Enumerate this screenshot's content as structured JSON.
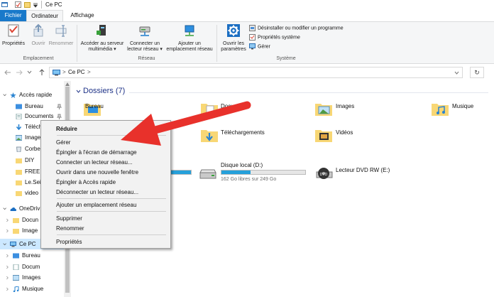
{
  "window": {
    "title": "Ce PC"
  },
  "ribbon_tabs": [
    {
      "label": "Fichier"
    },
    {
      "label": "Ordinateur"
    },
    {
      "label": "Affichage"
    }
  ],
  "ribbon": {
    "buttons": [
      {
        "label": "Propriétés",
        "icon": "checklist-properties-icon"
      },
      {
        "label": "Ouvrir",
        "icon": "open-icon"
      },
      {
        "label": "Renommer",
        "icon": "rename-icon"
      },
      {
        "label_line1": "Accéder au serveur",
        "label_line2": "multimédia ▾",
        "icon": "media-server-icon"
      },
      {
        "label_line1": "Connecter un",
        "label_line2": "lecteur réseau ▾",
        "icon": "network-drive-icon"
      },
      {
        "label_line1": "Ajouter un",
        "label_line2": "emplacement réseau",
        "icon": "network-location-icon"
      },
      {
        "label_line1": "Ouvrir les",
        "label_line2": "paramètres",
        "icon": "settings-gear-icon"
      }
    ],
    "system_items": [
      "Désinstaller ou modifier un programme",
      "Propriétés système",
      "Gérer"
    ],
    "groups": [
      "Emplacement",
      "Réseau",
      "Système"
    ]
  },
  "address": {
    "path_label": "Ce PC",
    "separator": ">",
    "refresh_symbol": "↻"
  },
  "nav_pane": {
    "items": [
      {
        "label": "Accès rapide",
        "icon": "star-icon",
        "level": 0
      },
      {
        "label": "Bureau",
        "icon": "desktop-folder-icon",
        "level": 1,
        "pinned": true
      },
      {
        "label": "Documents",
        "icon": "documents-folder-icon",
        "level": 1,
        "pinned": true
      },
      {
        "label": "Téléch",
        "icon": "download-arrow-icon",
        "level": 1
      },
      {
        "label": "Image",
        "icon": "pictures-folder-icon",
        "level": 1
      },
      {
        "label": "Corbei",
        "icon": "recycle-bin-icon",
        "level": 1
      },
      {
        "label": "DIY",
        "icon": "folder-icon",
        "level": 1
      },
      {
        "label": "FREELA",
        "icon": "folder-icon",
        "level": 1
      },
      {
        "label": "Le.Seig",
        "icon": "folder-icon",
        "level": 1
      },
      {
        "label": "video",
        "icon": "folder-icon",
        "level": 1
      },
      {
        "label": "OneDriv",
        "icon": "onedrive-cloud-icon",
        "level": 0
      },
      {
        "label": "Docun",
        "icon": "folder-icon",
        "level": 1
      },
      {
        "label": "Image",
        "icon": "folder-icon",
        "level": 1
      },
      {
        "label": "Ce PC",
        "icon": "computer-icon",
        "level": 0,
        "selected": true
      },
      {
        "label": "Bureau",
        "icon": "desktop-folder-icon",
        "level": 1
      },
      {
        "label": "Docum",
        "icon": "documents-folder-icon",
        "level": 1
      },
      {
        "label": "Images",
        "icon": "pictures-folder-icon",
        "level": 1
      },
      {
        "label": "Musique",
        "icon": "music-icon",
        "level": 1
      }
    ]
  },
  "content": {
    "folders_header": "Dossiers (7)",
    "folders": [
      {
        "label": "Bureau"
      },
      {
        "label": "Documents"
      },
      {
        "label": "Images"
      },
      {
        "label": "Musique"
      },
      {
        "label": "Téléchargements"
      },
      {
        "label": "Vidéos"
      }
    ],
    "drives": [
      {
        "label": "Disque local (D:)",
        "sub": "162 Go libres sur 249 Go",
        "used_fraction": 0.35
      },
      {
        "label": "Lecteur DVD RW (E:)"
      }
    ]
  },
  "context_menu": {
    "items": [
      {
        "label": "Réduire",
        "bold": true
      },
      {
        "label": "Gérer"
      },
      {
        "label": "Épingler à l'écran de démarrage"
      },
      {
        "label": "Connecter un lecteur réseau..."
      },
      {
        "label": "Ouvrir dans une nouvelle fenêtre"
      },
      {
        "label": "Épingler à Accès rapide"
      },
      {
        "label": "Déconnecter un lecteur réseau..."
      },
      {
        "label": "Ajouter un emplacement réseau"
      },
      {
        "label": "Supprimer"
      },
      {
        "label": "Renommer"
      },
      {
        "label": "Propriétés"
      }
    ]
  },
  "colors": {
    "accent": "#1979ca",
    "arrow": "#e8312b",
    "folder_yellow": "#f8d775",
    "section_header": "#1e3287"
  }
}
